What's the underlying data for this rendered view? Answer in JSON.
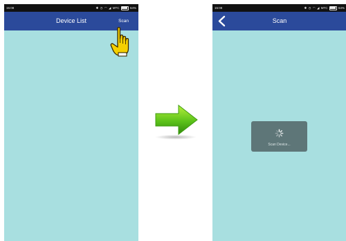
{
  "left_screen": {
    "status_time": "15:08",
    "status_carrier": "MTC",
    "status_battery": "64%",
    "title": "Device List",
    "scan_label": "Scan"
  },
  "right_screen": {
    "status_time": "15:08",
    "status_carrier": "MTC",
    "status_battery": "64%",
    "title": "Scan",
    "toast_text": "Scan Device..."
  },
  "icons": {
    "back": "chevron-left-icon",
    "pointer": "pointing-hand-icon",
    "transition": "right-arrow-icon",
    "loading": "spinner-icon"
  },
  "colors": {
    "appbar": "#2b4a9b",
    "screen_bg": "#a8dfe0",
    "status_bar": "#111111",
    "arrow": "#5cc21a",
    "hand": "#f5d000",
    "toast": "#5e7678"
  }
}
